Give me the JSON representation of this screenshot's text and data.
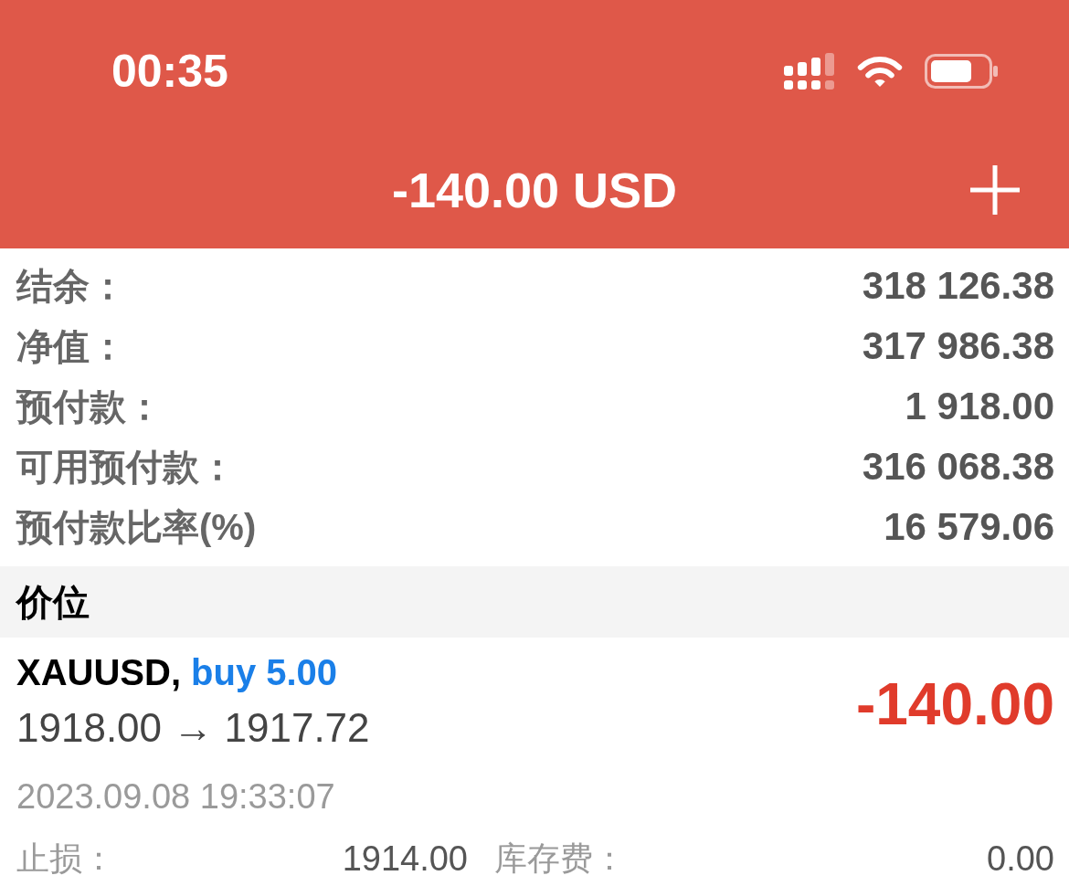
{
  "status_bar": {
    "time": "00:35"
  },
  "header": {
    "title": "-140.00 USD"
  },
  "account": [
    {
      "label": "结余：",
      "value": "318 126.38"
    },
    {
      "label": "净值：",
      "value": "317 986.38"
    },
    {
      "label": "预付款：",
      "value": "1 918.00"
    },
    {
      "label": "可用预付款：",
      "value": "316 068.38"
    },
    {
      "label": "预付款比率(%)",
      "value": "16 579.06"
    }
  ],
  "positions_section": {
    "title": "价位"
  },
  "positions": [
    {
      "symbol": "XAUUSD,",
      "order": "buy 5.00",
      "prices": "1918.00 → 1917.72",
      "profit": "-140.00",
      "time": "2023.09.08 19:33:07",
      "details": [
        {
          "label": "止损：",
          "value": "1914.00"
        },
        {
          "label": "库存费：",
          "value": "0.00"
        }
      ]
    }
  ]
}
